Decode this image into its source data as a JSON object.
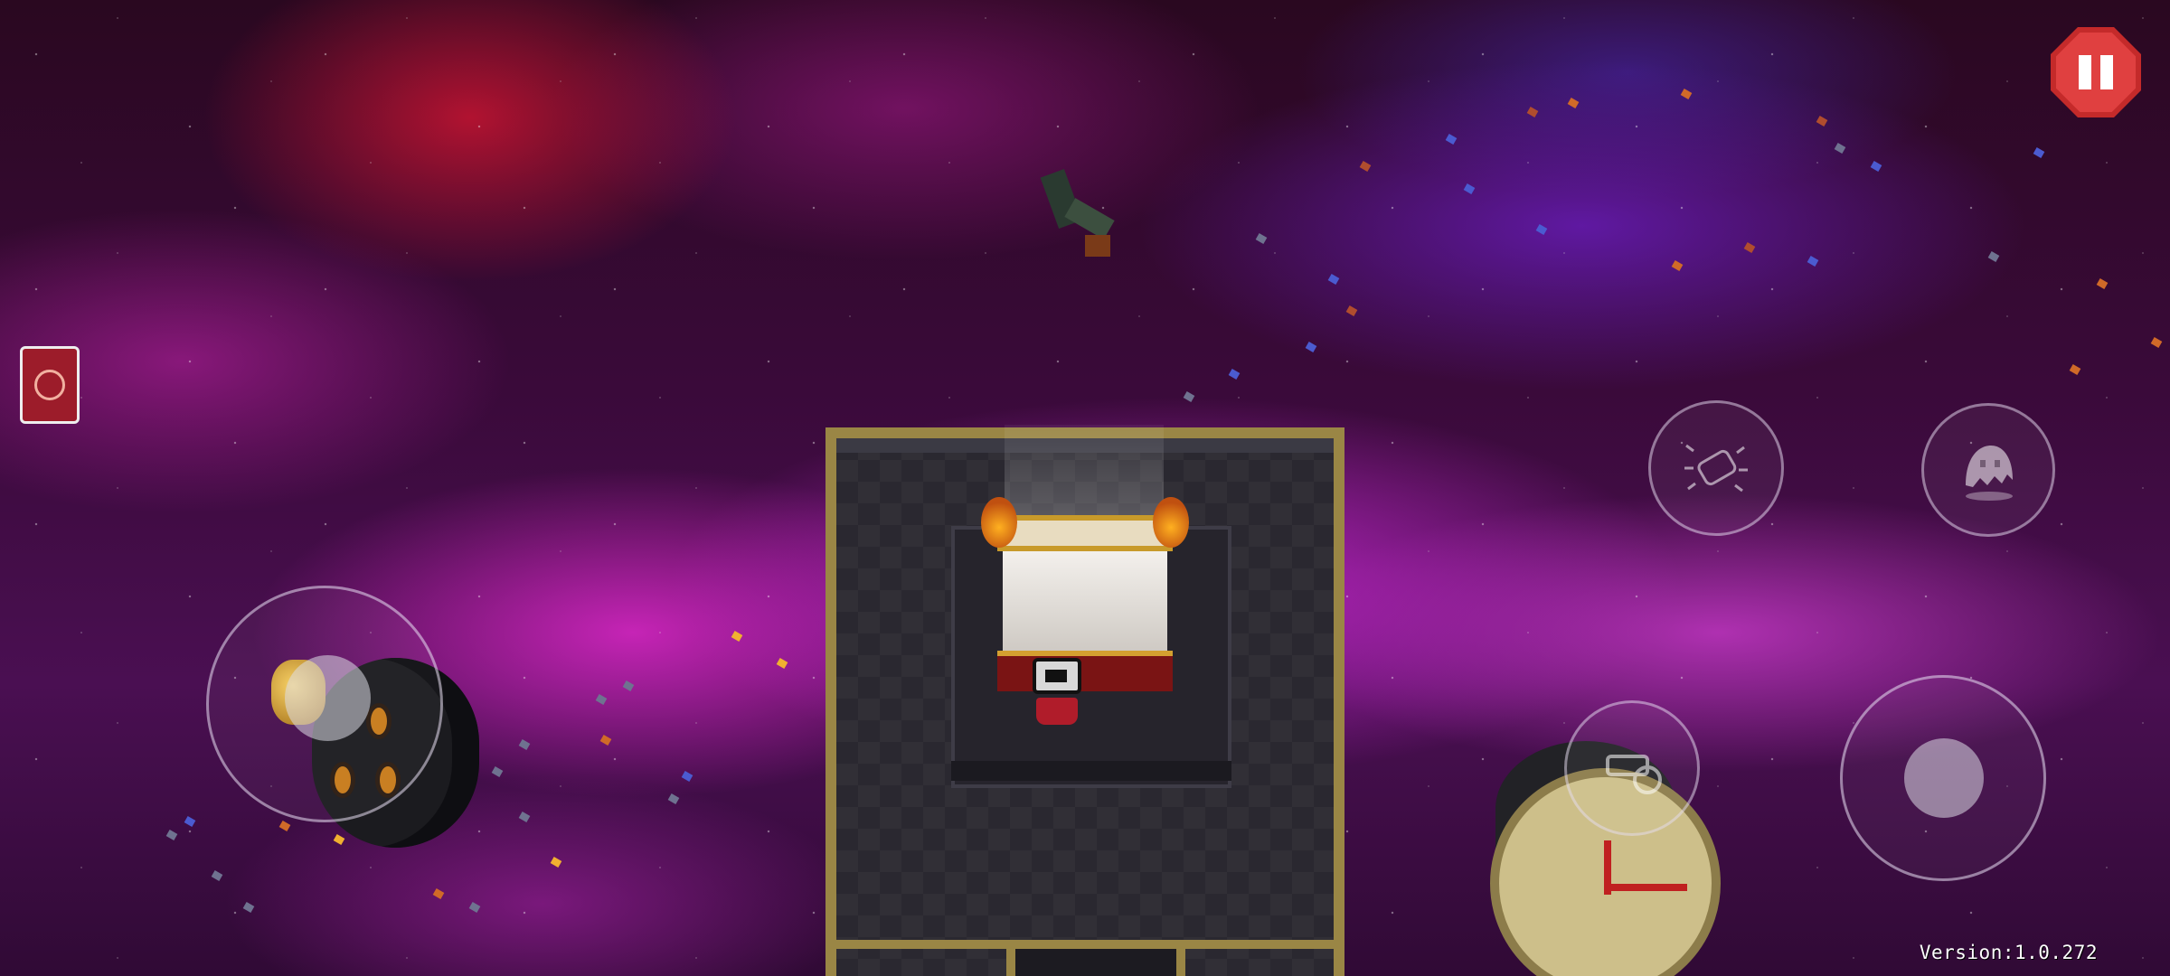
{
  "hud": {
    "version_label": "Version:1.0.272"
  },
  "controls": {
    "pause_icon": "pause-icon",
    "item_card_icon": "red-card-icon",
    "reload_icon": "bullet-reload-icon",
    "ghost_icon": "ghost-icon",
    "swap_icon": "weapon-swap-icon"
  },
  "colors": {
    "pause_red": "#e04040",
    "platform_gold": "#9a8645",
    "nebula_magenta": "#d028d0"
  }
}
